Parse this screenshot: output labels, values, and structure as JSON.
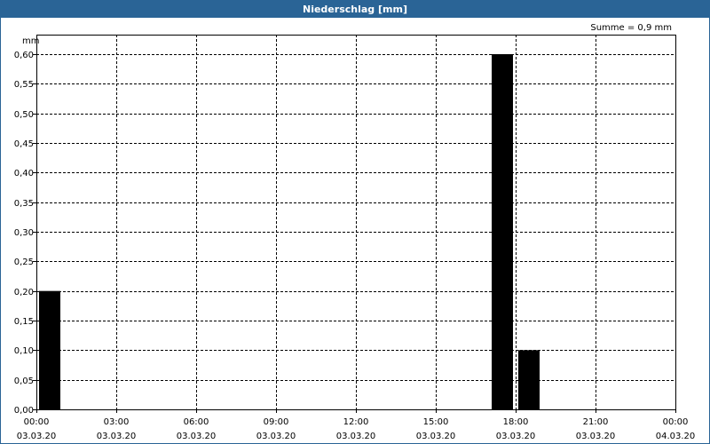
{
  "window": {
    "title": "Niederschlag [mm]"
  },
  "summary_text": "Summe = 0,9 mm",
  "unit_label": "mm",
  "colors": {
    "titlebar": "#2a6496",
    "bars": "#000000",
    "grid": "#000000"
  },
  "chart_data": {
    "type": "bar",
    "title": "Niederschlag [mm]",
    "ylabel": "mm",
    "xlabel": "",
    "ylim": [
      0,
      0.6
    ],
    "xlim": [
      "2020-03-03 00:00",
      "2020-03-04 00:00"
    ],
    "grid": true,
    "y_ticks": [
      "0,00",
      "0,05",
      "0,10",
      "0,15",
      "0,20",
      "0,25",
      "0,30",
      "0,35",
      "0,40",
      "0,45",
      "0,50",
      "0,55",
      "0,60"
    ],
    "x_ticks": [
      {
        "time": "00:00",
        "date": "03.03.20"
      },
      {
        "time": "03:00",
        "date": "03.03.20"
      },
      {
        "time": "06:00",
        "date": "03.03.20"
      },
      {
        "time": "09:00",
        "date": "03.03.20"
      },
      {
        "time": "12:00",
        "date": "03.03.20"
      },
      {
        "time": "15:00",
        "date": "03.03.20"
      },
      {
        "time": "18:00",
        "date": "03.03.20"
      },
      {
        "time": "21:00",
        "date": "03.03.20"
      },
      {
        "time": "00:00",
        "date": "04.03.20"
      }
    ],
    "bars": [
      {
        "start": "2020-03-03 00:00",
        "end": "2020-03-03 01:00",
        "value": 0.2
      },
      {
        "start": "2020-03-03 17:00",
        "end": "2020-03-03 18:00",
        "value": 0.6
      },
      {
        "start": "2020-03-03 18:00",
        "end": "2020-03-03 19:00",
        "value": 0.1
      }
    ],
    "total": "0,9 mm"
  }
}
